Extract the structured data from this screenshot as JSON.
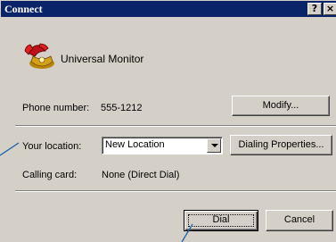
{
  "window": {
    "title": "Connect",
    "help_glyph": "?",
    "close_glyph": "×"
  },
  "connection_name": "Universal Monitor",
  "phone": {
    "label": "Phone number:",
    "value": "555-1212"
  },
  "modify_button": "Modify...",
  "location": {
    "label": "Your location:",
    "value": "New Location"
  },
  "dialing_properties_button": "Dialing Properties...",
  "calling_card": {
    "label": "Calling card:",
    "value": "None (Direct Dial)"
  },
  "dial_button": "Dial",
  "cancel_button": "Cancel",
  "icons": {
    "connection": "phone-icon"
  }
}
